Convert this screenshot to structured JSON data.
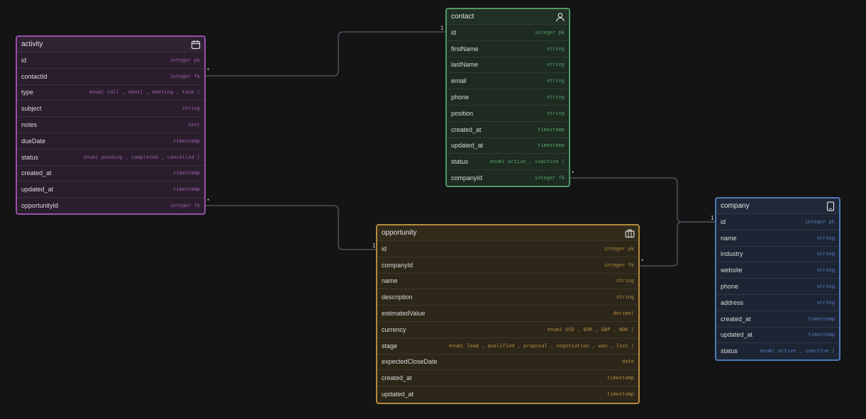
{
  "colors": {
    "background": "#141414",
    "activity": "#9a4fa8",
    "contact": "#4e9a63",
    "company": "#4f7ab8",
    "opportunity": "#b58a3e",
    "link": "#5a5a6e"
  },
  "entities": {
    "activity": {
      "title": "activity",
      "icon": "calendar-icon",
      "fields": [
        {
          "name": "id",
          "type": "integer pk"
        },
        {
          "name": "contactId",
          "type": "integer fk"
        },
        {
          "name": "type",
          "type": "enum( call , email , meeting , task )"
        },
        {
          "name": "subject",
          "type": "string"
        },
        {
          "name": "notes",
          "type": "text"
        },
        {
          "name": "dueDate",
          "type": "timestamp"
        },
        {
          "name": "status",
          "type": "enum( pending , completed , cancelled )"
        },
        {
          "name": "created_at",
          "type": "timestamp"
        },
        {
          "name": "updated_at",
          "type": "timestamp"
        },
        {
          "name": "opportunityId",
          "type": "integer fk"
        }
      ]
    },
    "contact": {
      "title": "contact",
      "icon": "user-icon",
      "fields": [
        {
          "name": "id",
          "type": "integer pk"
        },
        {
          "name": "firstName",
          "type": "string"
        },
        {
          "name": "lastName",
          "type": "string"
        },
        {
          "name": "email",
          "type": "string"
        },
        {
          "name": "phone",
          "type": "string"
        },
        {
          "name": "position",
          "type": "string"
        },
        {
          "name": "created_at",
          "type": "timestamp"
        },
        {
          "name": "updated_at",
          "type": "timestamp"
        },
        {
          "name": "status",
          "type": "enum( active , inactive )"
        },
        {
          "name": "companyId",
          "type": "integer fk"
        }
      ]
    },
    "company": {
      "title": "company",
      "icon": "tablet-icon",
      "fields": [
        {
          "name": "id",
          "type": "integer pk"
        },
        {
          "name": "name",
          "type": "string"
        },
        {
          "name": "industry",
          "type": "string"
        },
        {
          "name": "website",
          "type": "string"
        },
        {
          "name": "phone",
          "type": "string"
        },
        {
          "name": "address",
          "type": "string"
        },
        {
          "name": "created_at",
          "type": "timestamp"
        },
        {
          "name": "updated_at",
          "type": "timestamp"
        },
        {
          "name": "status",
          "type": "enum( active , inactive )"
        }
      ]
    },
    "opportunity": {
      "title": "opportunity",
      "icon": "briefcase-icon",
      "fields": [
        {
          "name": "id",
          "type": "integer pk"
        },
        {
          "name": "companyId",
          "type": "integer fk"
        },
        {
          "name": "name",
          "type": "string"
        },
        {
          "name": "description",
          "type": "string"
        },
        {
          "name": "estimatedValue",
          "type": "decimal"
        },
        {
          "name": "currency",
          "type": "enum( USD , EUR , GBP , NOK )"
        },
        {
          "name": "stage",
          "type": "enum( lead , qualified , proposal , negotiation , won , lost )"
        },
        {
          "name": "expectedCloseDate",
          "type": "date"
        },
        {
          "name": "created_at",
          "type": "timestamp"
        },
        {
          "name": "updated_at",
          "type": "timestamp"
        }
      ]
    }
  },
  "relations": [
    {
      "from": "activity.contactId",
      "to": "contact.id",
      "from_card": "*",
      "to_card": "1"
    },
    {
      "from": "activity.opportunityId",
      "to": "opportunity.id",
      "from_card": "*",
      "to_card": "1"
    },
    {
      "from": "contact.companyId",
      "to": "company.id",
      "from_card": "*",
      "to_card": "1"
    },
    {
      "from": "opportunity.companyId",
      "to": "company.id",
      "from_card": "*",
      "to_card": "1"
    }
  ]
}
